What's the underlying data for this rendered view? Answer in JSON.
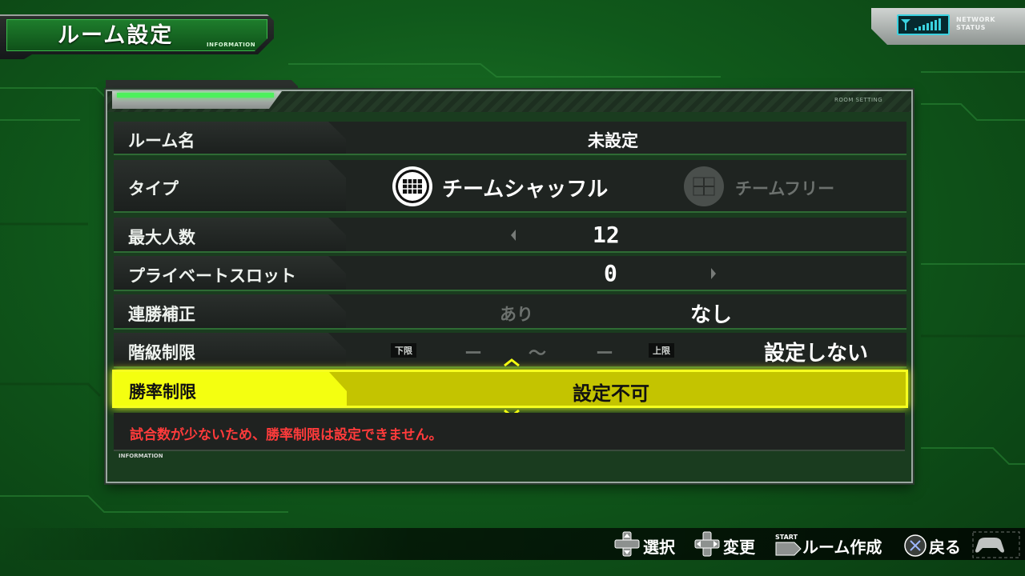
{
  "header": {
    "title": "ルーム設定",
    "subtitle": "INFORMATION"
  },
  "network": {
    "label_line1": "NETWORK",
    "label_line2": "STATUS",
    "icon": "signal-antenna-icon"
  },
  "panel": {
    "section_label": "ROOM SETTING",
    "rows": {
      "room_name": {
        "label": "ルーム名",
        "value": "未設定"
      },
      "type": {
        "label": "タイプ",
        "option_selected": "チームシャッフル",
        "option_other": "チームフリー"
      },
      "max_players": {
        "label": "最大人数",
        "value": "12"
      },
      "private_slot": {
        "label": "プライベートスロット",
        "value": "0"
      },
      "win_streak": {
        "label": "連勝補正",
        "option_off": "あり",
        "option_selected": "なし"
      },
      "rank_limit": {
        "label": "階級制限",
        "lower_tag": "下限",
        "lower_value": "ー",
        "range_sep": "〜",
        "upper_value": "ー",
        "upper_tag": "上限",
        "value": "設定しない"
      },
      "win_rate_limit": {
        "label": "勝率制限",
        "value": "設定不可"
      }
    },
    "info": {
      "label": "INFORMATION",
      "message": "試合数が少ないため、勝率制限は設定できません。"
    }
  },
  "footer": {
    "hints": [
      {
        "icon": "dpad-vertical-icon",
        "label": "選択"
      },
      {
        "icon": "dpad-horizontal-icon",
        "label": "変更"
      },
      {
        "icon": "start-button-icon",
        "label": "ルーム作成",
        "small": "START"
      },
      {
        "icon": "cross-button-icon",
        "label": "戻る"
      }
    ]
  },
  "colors": {
    "background": "#10591b",
    "highlight": "#f4ff10",
    "warning": "#ff3b3b",
    "accent_green": "#4df05c"
  }
}
